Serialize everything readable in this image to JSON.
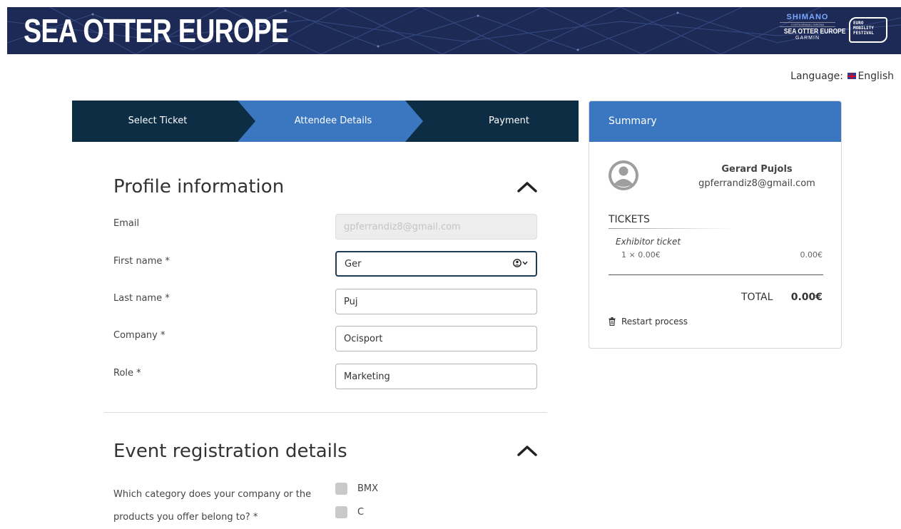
{
  "header": {
    "brand_title": "SEA OTTER EUROPE",
    "sponsor_logo": {
      "line1": "SHIMANO",
      "line2": "COSTA BRAVA | GIRONA",
      "line3": "SEA OTTER EUROPE",
      "line4": "GARMIN"
    },
    "festival_logo": {
      "line1": "EURO",
      "line2": "MOBILITY",
      "line3": "FESTIVAL"
    }
  },
  "language": {
    "label": "Language:",
    "value": "English"
  },
  "steps": {
    "items": [
      {
        "label": "Select Ticket",
        "state": "completed"
      },
      {
        "label": "Attendee Details",
        "state": "active"
      },
      {
        "label": "Payment",
        "state": "pending"
      }
    ]
  },
  "profile": {
    "title": "Profile information",
    "fields": {
      "email": {
        "label": "Email",
        "value": "gpferrandiz8@gmail.com"
      },
      "first_name": {
        "label": "First name *",
        "value": "Ger"
      },
      "last_name": {
        "label": "Last name *",
        "value": "Puj"
      },
      "company": {
        "label": "Company *",
        "value": "Ocisport"
      },
      "role": {
        "label": "Role *",
        "value": "Marketing"
      }
    }
  },
  "event": {
    "title": "Event registration details",
    "question": "Which category does your company or the products you offer belong to? *",
    "options": [
      "BMX",
      "C"
    ]
  },
  "summary": {
    "title": "Summary",
    "user_name": "Gerard Pujols",
    "user_email": "gpferrandiz8@gmail.com",
    "tickets_heading": "TICKETS",
    "ticket_name": "Exhibitor ticket",
    "ticket_qty": "1 × 0.00€",
    "ticket_price": "0.00€",
    "total_label": "TOTAL",
    "total_value": "0.00€",
    "restart_label": "Restart process"
  },
  "colors": {
    "banner_bg": "#1c2a55",
    "step_dark": "#0d2d45",
    "step_active": "#3a77c0",
    "summary_header": "#3a77c0"
  }
}
